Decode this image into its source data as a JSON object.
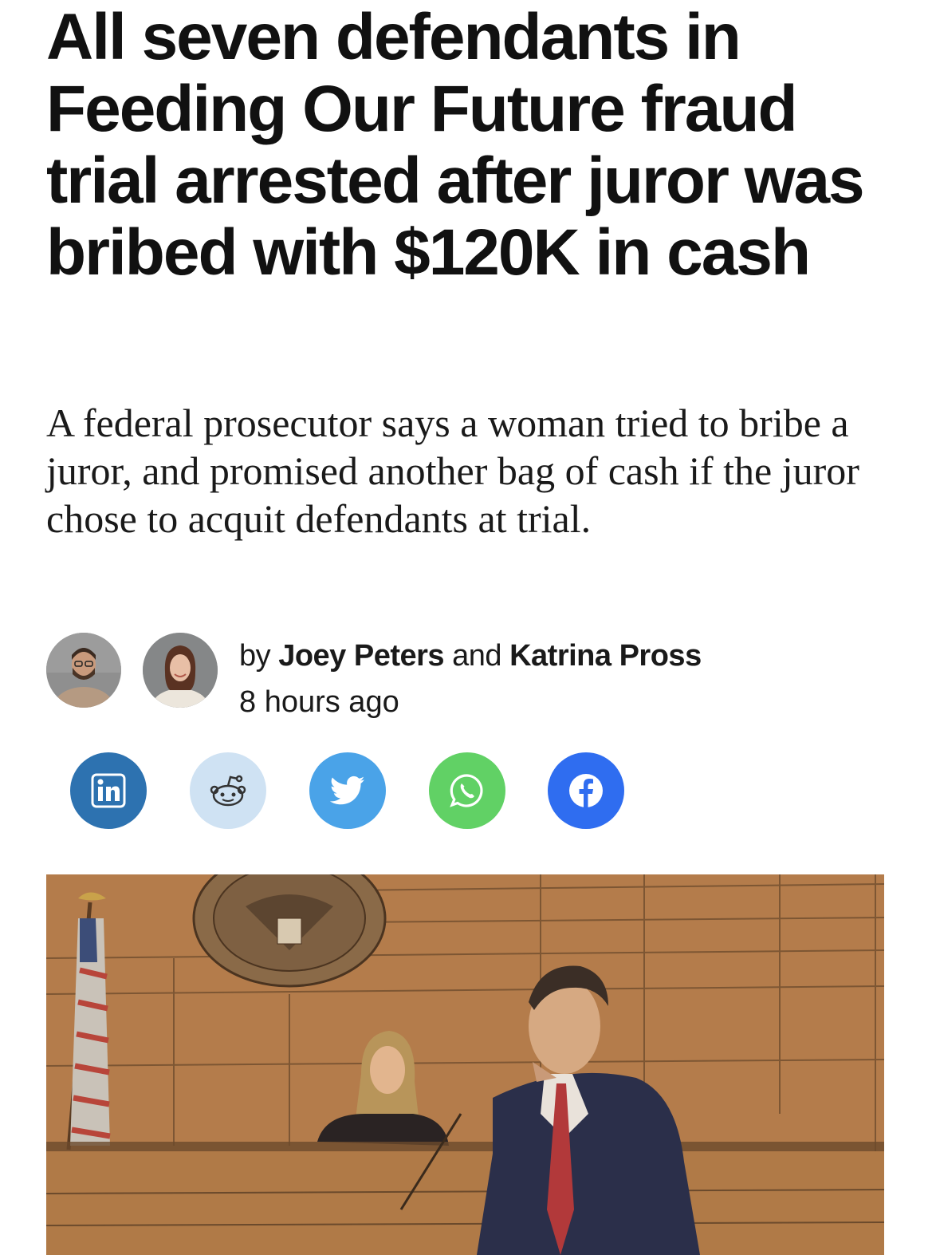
{
  "article": {
    "headline": "All seven defendants in Feeding Our Future fraud trial arrested after juror was bribed with $120K in cash",
    "dek": "A federal prosecutor says a woman tried to bribe a juror, and promised another bag of cash if the juror chose to acquit defendants at trial."
  },
  "byline": {
    "prefix": "by",
    "author_1": "Joey Peters",
    "conjunction": "and",
    "author_2": "Katrina Pross",
    "timestamp": "8 hours ago"
  },
  "share": {
    "buttons": [
      {
        "icon": "linkedin-icon",
        "color": "#2d72b0"
      },
      {
        "icon": "reddit-icon",
        "color": "#cfe2f3"
      },
      {
        "icon": "twitter-icon",
        "color": "#4aa3e8"
      },
      {
        "icon": "whatsapp-icon",
        "color": "#61d165"
      },
      {
        "icon": "facebook-icon",
        "color": "#2f6df0"
      }
    ]
  },
  "image": {
    "description_icon": "courtroom-sketch-image"
  },
  "colors": {
    "text": "#111111",
    "sketch_background": "#b9814f"
  }
}
